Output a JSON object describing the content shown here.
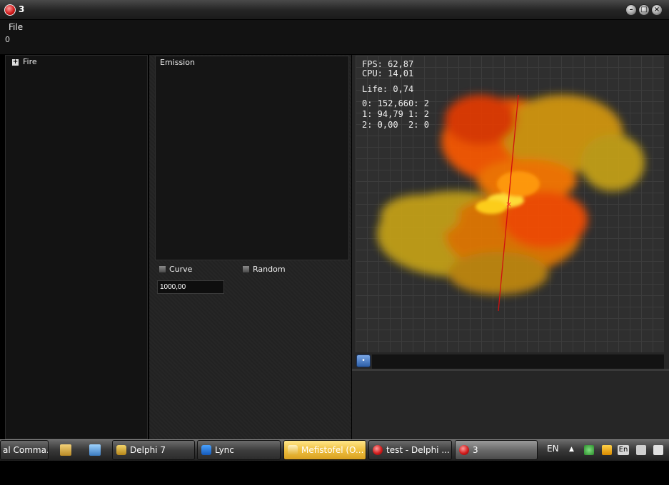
{
  "window": {
    "title": "3"
  },
  "menu": {
    "file": "File"
  },
  "status": {
    "counter": "0"
  },
  "tree": {
    "items": [
      {
        "label": "Fire",
        "expander": "+"
      }
    ]
  },
  "emission": {
    "label": "Emission",
    "curve_label": "Curve",
    "random_label": "Random",
    "value": "1000,00"
  },
  "hud": {
    "fps": "FPS: 62,87",
    "cpu": "CPU: 14,01",
    "life": "Life: 0,74",
    "row0": "0: 152,660: 2",
    "row1": "1: 94,79 1: 2",
    "row2": "2: 0,00  2: 0"
  },
  "timeline": {
    "play_glyph": "•"
  },
  "taskbar": {
    "items": [
      {
        "label": "al Comma..."
      },
      {
        "label": "Delphi 7"
      },
      {
        "label": "Lync"
      },
      {
        "label": "Mefistofel (O..."
      },
      {
        "label": "test - Delphi ..."
      },
      {
        "label": "3"
      }
    ],
    "lang": "EN",
    "tray_lang_badge": "En"
  },
  "colors": {
    "accent": "#d21e1e",
    "fire_orange": "#ff6a00",
    "fire_yellow": "#e6c21a",
    "axis": "#d01010"
  }
}
